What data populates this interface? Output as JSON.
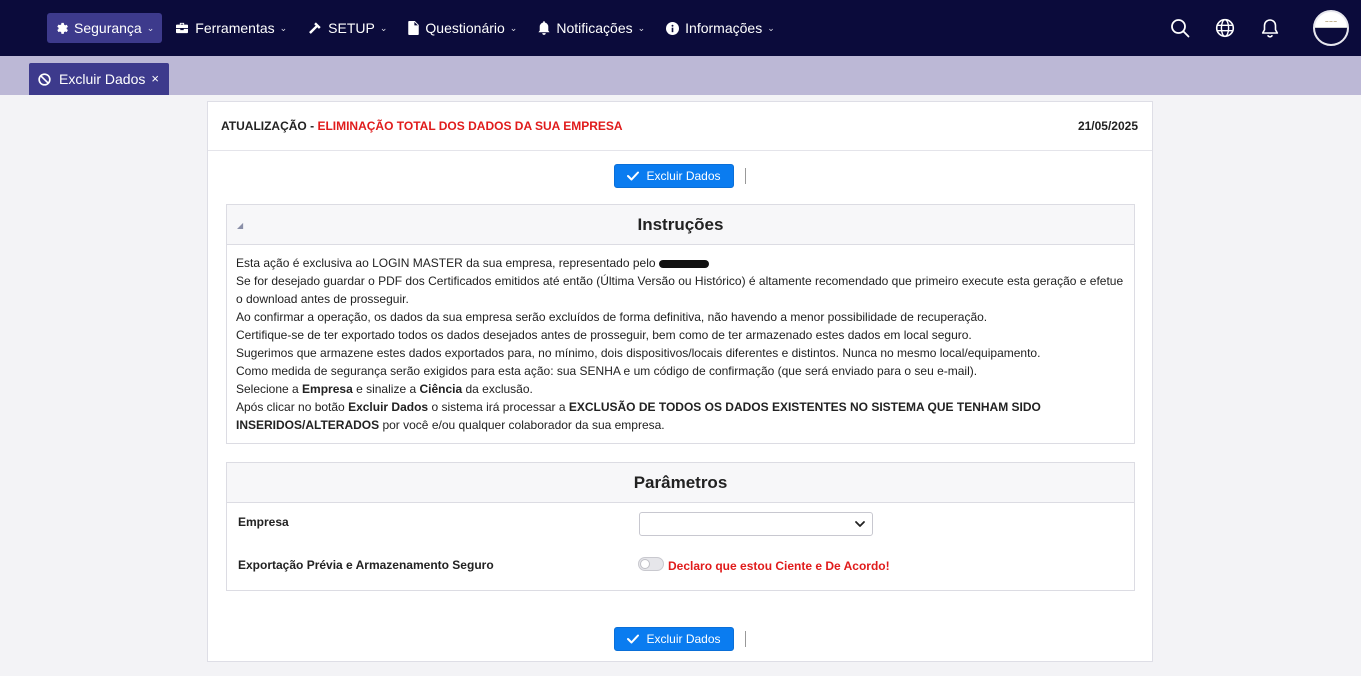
{
  "nav": {
    "items": [
      {
        "label": "Segurança",
        "icon": "gear-icon",
        "active": true
      },
      {
        "label": "Ferramentas",
        "icon": "toolbox-icon"
      },
      {
        "label": "SETUP",
        "icon": "hammer-icon"
      },
      {
        "label": "Questionário",
        "icon": "document-icon"
      },
      {
        "label": "Notificações",
        "icon": "bell-icon"
      },
      {
        "label": "Informações",
        "icon": "info-icon"
      }
    ],
    "right_icons": [
      "search-icon",
      "globe-icon",
      "bell-icon",
      "avatar"
    ]
  },
  "tab": {
    "label": "Excluir Dados",
    "icon": "ban-icon",
    "close": "×"
  },
  "header": {
    "prefix": "ATUALIZAÇÃO - ",
    "highlight": "ELIMINAÇÃO TOTAL DOS DADOS DA SUA EMPRESA",
    "date": "21/05/2025"
  },
  "button": {
    "label": "Excluir Dados"
  },
  "instructions": {
    "title": "Instruções",
    "lines": {
      "l1": "Esta ação é exclusiva ao LOGIN MASTER da sua empresa, representado pelo",
      "l2": "Se for desejado guardar o PDF dos Certificados emitidos até então (Última Versão ou Histórico) é altamente recomendado que primeiro execute esta geração e efetue o download antes de prosseguir.",
      "l3": "Ao confirmar a operação, os dados da sua empresa serão excluídos de forma definitiva, não havendo a menor possibilidade de recuperação.",
      "l4": "Certifique-se de ter exportado todos os dados desejados antes de prosseguir, bem como de ter armazenado estes dados em local seguro.",
      "l5": "Sugerimos que armazene estes dados exportados para, no mínimo, dois dispositivos/locais diferentes e distintos. Nunca no mesmo local/equipamento.",
      "l6": "Como medida de segurança serão exigidos para esta ação: sua SENHA e um código de confirmação (que será enviado para o seu e-mail).",
      "l7a": "Selecione a ",
      "l7b": "Empresa",
      "l7c": " e sinalize a ",
      "l7d": "Ciência",
      "l7e": " da exclusão.",
      "l8a": "Após clicar no botão ",
      "l8b": "Excluir Dados",
      "l8c": " o sistema irá processar a ",
      "l8d": "EXCLUSÃO DE TODOS OS DADOS EXISTENTES NO SISTEMA QUE TENHAM SIDO INSERIDOS/ALTERADOS",
      "l8e": " por você e/ou qualquer colaborador da sua empresa."
    }
  },
  "params": {
    "title": "Parâmetros",
    "empresa_label": "Empresa",
    "empresa_value": "",
    "export_label": "Exportação Prévia e Armazenamento Seguro",
    "consent_text": "Declaro que estou Ciente e De Acordo!",
    "consent_checked": false
  },
  "colors": {
    "navbar": "#0b0b3b",
    "active": "#3d3a8c",
    "primary": "#0a7cf0",
    "danger": "#e01b1b",
    "tabbar": "#bcb8d6"
  }
}
